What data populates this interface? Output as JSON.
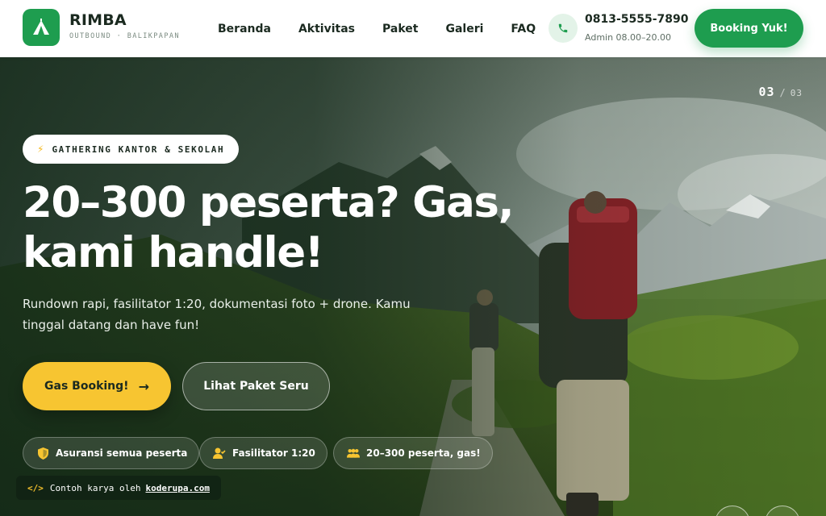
{
  "brand": {
    "name": "RIMBA",
    "tagline": "OUTBOUND · BALIKPAPAN"
  },
  "nav": {
    "items": [
      {
        "label": "Beranda"
      },
      {
        "label": "Aktivitas"
      },
      {
        "label": "Paket"
      },
      {
        "label": "Galeri"
      },
      {
        "label": "FAQ"
      }
    ]
  },
  "contact": {
    "phone": "0813-5555-7890",
    "hours": "Admin 08.00–20.00"
  },
  "header_cta": {
    "label": "Booking Yuk!"
  },
  "hero": {
    "slide_current": "03",
    "slide_separator": "/",
    "slide_total": "03",
    "tag": "GATHERING KANTOR & SEKOLAH",
    "headline_line1": "20–300 peserta? Gas,",
    "headline_line2": "kami handle!",
    "subline": "Rundown rapi, fasilitator 1:20, dokumentasi foto + drone. Kamu tinggal datang dan have fun!",
    "primary_button": "Gas Booking!",
    "secondary_button": "Lihat Paket Seru",
    "features": [
      {
        "label": "Asuransi semua peserta",
        "icon": "shield-icon"
      },
      {
        "label": "Fasilitator 1:20",
        "icon": "user-check-icon"
      },
      {
        "label": "20–300 peserta, gas!",
        "icon": "users-icon"
      }
    ]
  },
  "credit": {
    "code_symbol": "</>",
    "text": "Contoh karya oleh",
    "link": "koderupa.com"
  },
  "colors": {
    "brand_green": "#1e9d4f",
    "accent_yellow": "#f7c531",
    "dark_text": "#1b2a20"
  }
}
